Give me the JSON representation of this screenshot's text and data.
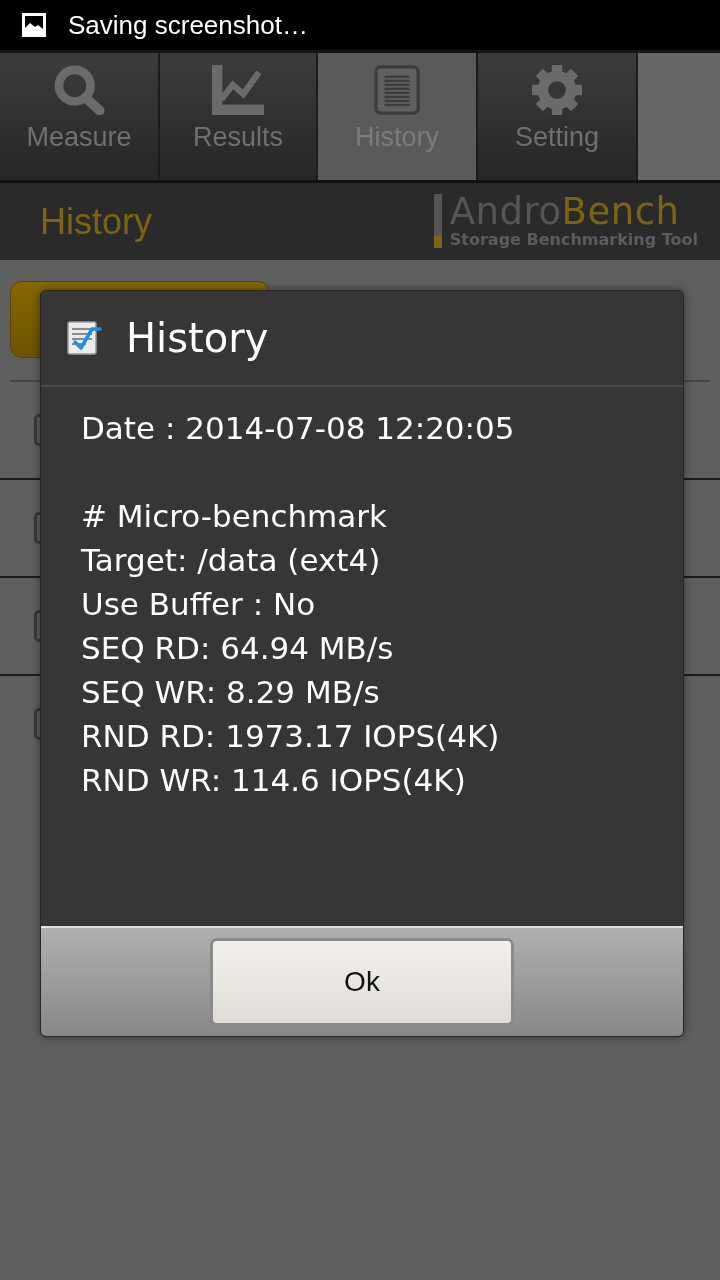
{
  "status_bar": {
    "text": "Saving screenshot…"
  },
  "tabs": [
    {
      "label": "Measure",
      "selected": false
    },
    {
      "label": "Results",
      "selected": false
    },
    {
      "label": "History",
      "selected": true
    },
    {
      "label": "Setting",
      "selected": false
    }
  ],
  "header": {
    "title": "History",
    "logo": {
      "name": [
        "Andro",
        "Bench"
      ],
      "tagline": "Storage Benchmarking Tool"
    }
  },
  "history_rows": [
    {
      "checked": false
    },
    {
      "checked": false
    },
    {
      "checked": false
    },
    {
      "checked": false
    }
  ],
  "dialog": {
    "title": "History",
    "sections": [
      [
        "Date : 2014-07-08 12:20:05"
      ],
      [
        "# Micro-benchmark",
        "Target: /data (ext4)",
        "Use Buffer : No",
        "SEQ RD: 64.94 MB/s",
        "SEQ WR: 8.29 MB/s",
        "RND RD: 1973.17 IOPS(4K)",
        "RND WR: 114.6 IOPS(4K)"
      ]
    ],
    "button": "Ok"
  }
}
